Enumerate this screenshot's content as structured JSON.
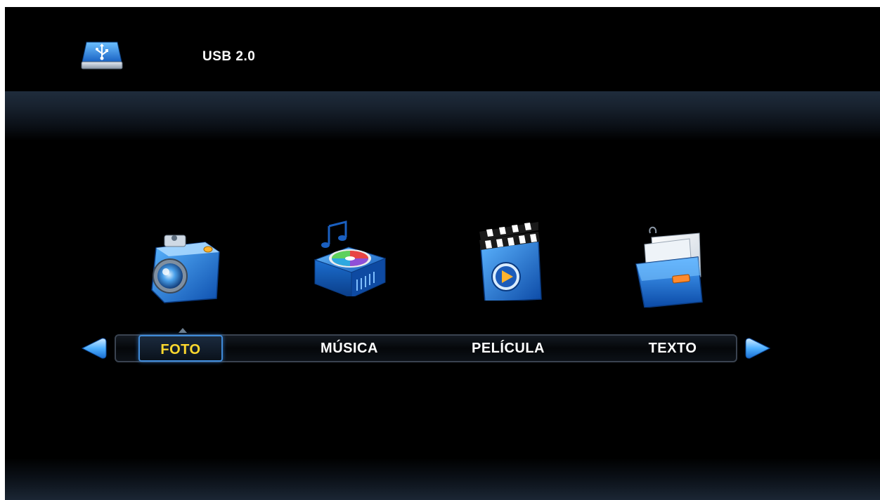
{
  "header": {
    "device_icon": "usb-drive-icon",
    "device_title": "USB 2.0"
  },
  "menu": {
    "selected_index": 0,
    "items": [
      {
        "label": "FOTO",
        "icon": "camera-icon"
      },
      {
        "label": "MÚSICA",
        "icon": "music-player-icon"
      },
      {
        "label": "PELÍCULA",
        "icon": "clapperboard-icon"
      },
      {
        "label": "TEXTO",
        "icon": "folder-document-icon"
      }
    ],
    "prev_icon": "arrow-left-icon",
    "next_icon": "arrow-right-icon"
  },
  "colors": {
    "background": "#000000",
    "selected_text": "#ffd92e",
    "menu_text": "#ffffff",
    "selection_border": "#3f8ad8",
    "accent_blue": "#1f7ad8"
  }
}
